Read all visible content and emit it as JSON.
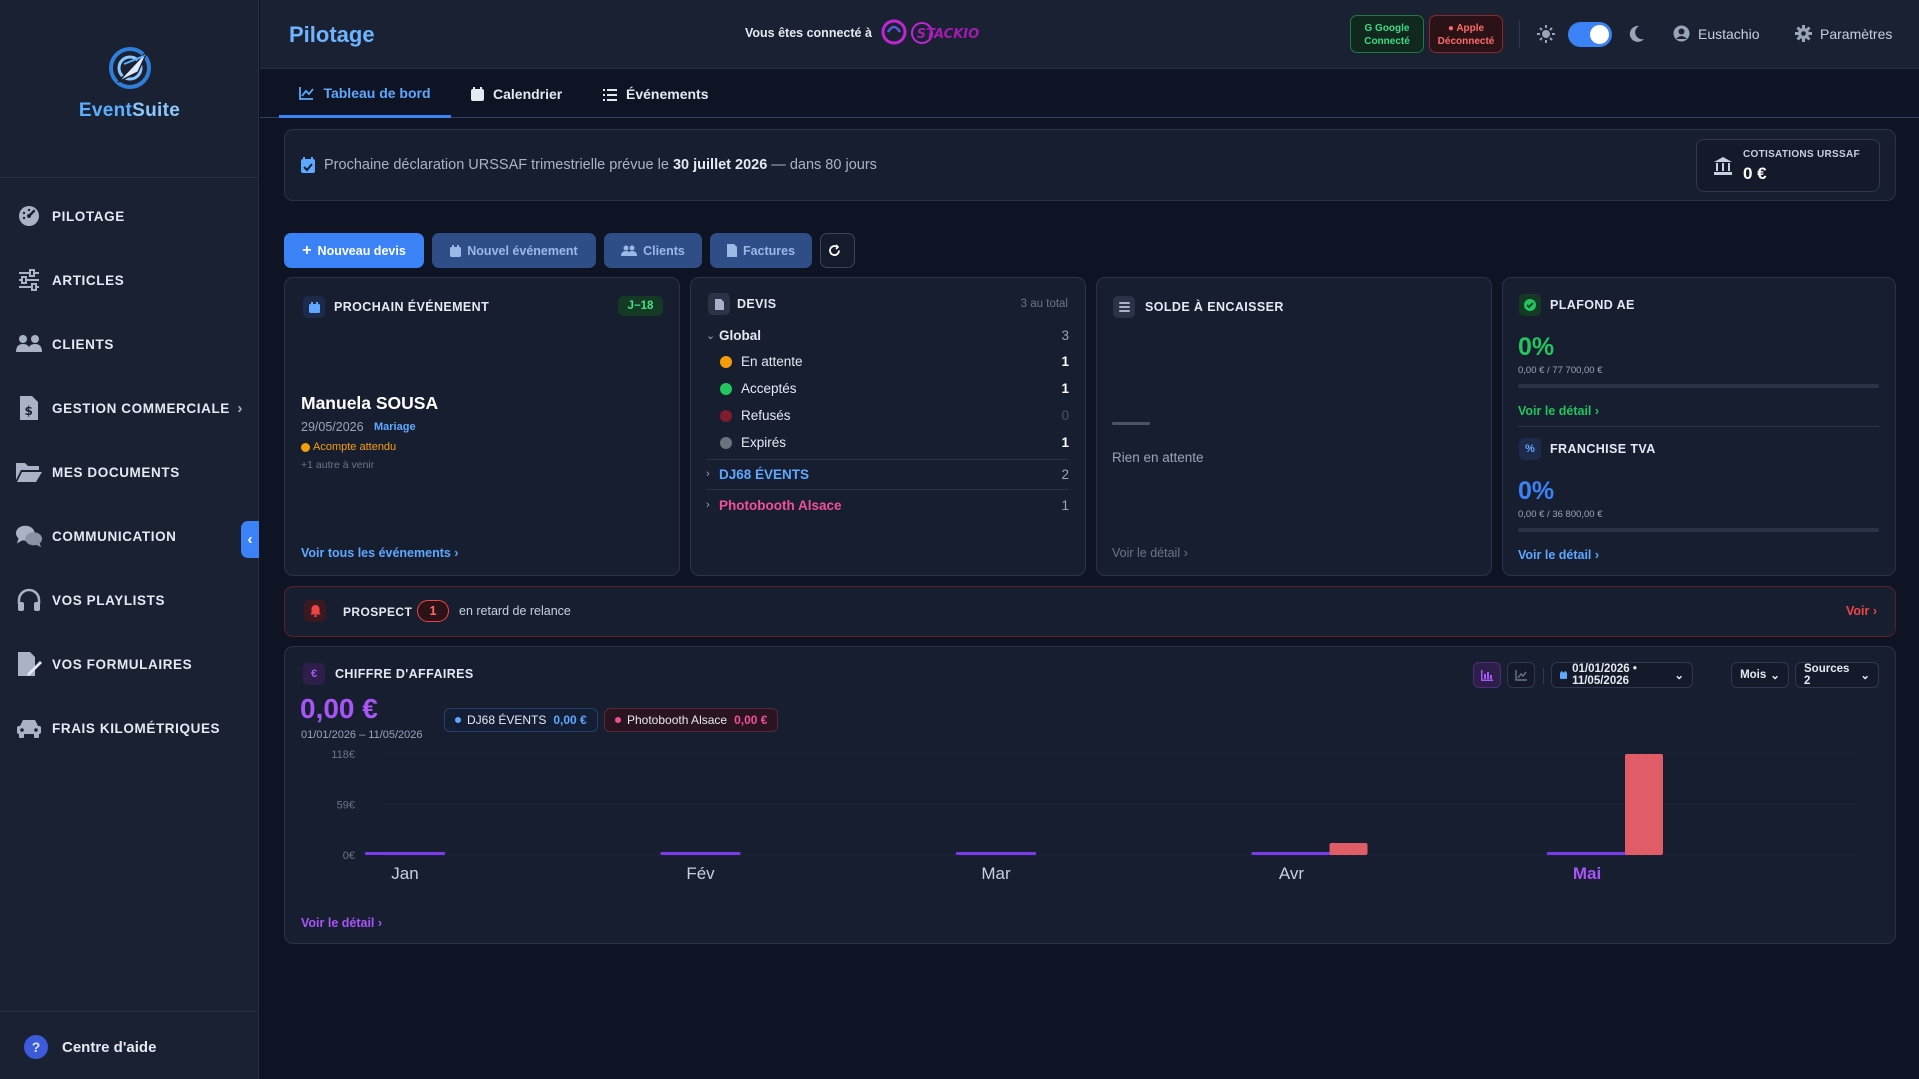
{
  "sidebar": {
    "brand": {
      "part1": "Event",
      "part2": "Suite"
    },
    "items": [
      {
        "label": "PILOTAGE",
        "icon": "gauge-icon"
      },
      {
        "label": "ARTICLES",
        "icon": "sliders-icon"
      },
      {
        "label": "CLIENTS",
        "icon": "users-icon"
      },
      {
        "label": "GESTION COMMERCIALE",
        "icon": "invoice-dollar-icon",
        "has_chevron": true
      },
      {
        "label": "MES DOCUMENTS",
        "icon": "folder-open-icon"
      },
      {
        "label": "COMMUNICATION",
        "icon": "chat-bubbles-icon"
      },
      {
        "label": "VOS PLAYLISTS",
        "icon": "headphones-icon"
      },
      {
        "label": "VOS FORMULAIRES",
        "icon": "form-edit-icon"
      },
      {
        "label": "FRAIS KILOMÉTRIQUES",
        "icon": "car-icon"
      }
    ],
    "chevron": "›",
    "collapse_glyph": "‹",
    "help": {
      "glyph": "?",
      "label": "Centre d'aide"
    }
  },
  "header": {
    "title": "Pilotage",
    "connected_text": "Vous êtes connecté à",
    "partner_logo_text": "STACKIO",
    "google": {
      "name": "Google",
      "status": "Connecté",
      "color": "#3ddc84"
    },
    "apple": {
      "name": "Apple",
      "status": "Déconnecté",
      "color": "#ff6b6b"
    },
    "theme_dark": true,
    "user": "Eustachio",
    "settings": "Paramètres"
  },
  "tabs": [
    {
      "label": "Tableau de bord",
      "active": true
    },
    {
      "label": "Calendrier",
      "active": false
    },
    {
      "label": "Événements",
      "active": false
    }
  ],
  "urssaf": {
    "text_before": "Prochaine déclaration URSSAF trimestrielle prévue le ",
    "date": "30 juillet 2026",
    "text_after": " — dans 80 jours",
    "box_label": "COTISATIONS URSSAF",
    "box_value": "0 €"
  },
  "actions": {
    "new_quote": "Nouveau devis",
    "new_event": "Nouvel événement",
    "clients": "Clients",
    "invoices": "Factures"
  },
  "next_event": {
    "heading": "PROCHAIN ÉVÉNEMENT",
    "badge": "J−18",
    "client": "Manuela SOUSA",
    "date": "29/05/2026",
    "type": "Mariage",
    "deposit": "Acompte attendu",
    "more": "+1 autre à venir",
    "link": "Voir tous les événements"
  },
  "quotes": {
    "heading": "DEVIS",
    "total": "3 au total",
    "global_label": "Global",
    "global_count": "3",
    "statuses": [
      {
        "label": "En attente",
        "count": "1",
        "color": "#f59e0b"
      },
      {
        "label": "Acceptés",
        "count": "1",
        "color": "#22c55e"
      },
      {
        "label": "Refusés",
        "count": "0",
        "color": "#7f1d2d"
      },
      {
        "label": "Expirés",
        "count": "1",
        "color": "#6b7280"
      }
    ],
    "groups": [
      {
        "label": "DJ68 ÉVENTS",
        "count": "2",
        "color": "#5ea8ff"
      },
      {
        "label": "Photobooth Alsace",
        "count": "1",
        "color": "#f0509a"
      }
    ]
  },
  "balance": {
    "heading": "SOLDE À ENCAISSER",
    "empty": "Rien en attente",
    "link": "Voir le détail"
  },
  "ceiling": {
    "heading": "PLAFOND AE",
    "percent": "0%",
    "detail": "0,00 € / 77 700,00 €",
    "fill": 0,
    "link": "Voir le détail",
    "vat_heading": "FRANCHISE TVA",
    "vat_percent": "0%",
    "vat_detail": "0,00 € / 36 800,00 €",
    "vat_fill": 0,
    "vat_link": "Voir le détail"
  },
  "prospect": {
    "label": "PROSPECT",
    "count": "1",
    "text": "en retard de relance",
    "link": "Voir"
  },
  "revenue": {
    "heading": "CHIFFRE D'AFFAIRES",
    "amount": "0,00 €",
    "period": "01/01/2026 – 11/05/2026",
    "sources": [
      {
        "name": "DJ68 ÉVENTS",
        "value": "0,00 €",
        "color": "#5ea8ff"
      },
      {
        "name": "Photobooth Alsace",
        "value": "0,00 €",
        "color": "#f0509a"
      }
    ],
    "date_range": "01/01/2026 • 11/05/2026",
    "granularity": "Mois",
    "sources_filter": "Sources 2",
    "link": "Voir le détail"
  },
  "chart_data": {
    "type": "bar",
    "categories": [
      "Jan",
      "Fév",
      "Mar",
      "Avr",
      "Mai"
    ],
    "y_ticks": [
      "118€",
      "59€",
      "0€"
    ],
    "ylim": [
      0,
      118
    ],
    "highlight_category": "Mai",
    "series": [
      {
        "values": [
          0,
          0,
          0,
          0,
          0
        ],
        "color": "#7c3aed"
      },
      {
        "values": [
          0,
          0,
          0,
          14,
          118
        ],
        "color": "#e05c66"
      }
    ],
    "grid": true
  }
}
